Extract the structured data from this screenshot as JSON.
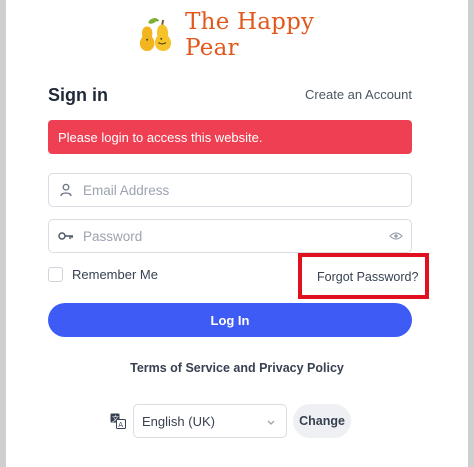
{
  "brand": {
    "name": "The Happy Pear",
    "logo_icon": "pear-icon"
  },
  "header": {
    "title": "Sign in",
    "create_account": "Create an Account"
  },
  "alert": {
    "message": "Please login to access this website.",
    "color": "#ef4053"
  },
  "form": {
    "email": {
      "placeholder": "Email Address",
      "value": "",
      "icon": "user-icon"
    },
    "password": {
      "placeholder": "Password",
      "value": "",
      "icon": "key-icon",
      "toggle_icon": "eye-icon"
    },
    "remember_me": {
      "label": "Remember Me",
      "checked": false
    },
    "forgot_password": "Forgot Password?",
    "login_button": "Log In"
  },
  "footer": {
    "terms": "Terms of Service and Privacy Policy",
    "language": {
      "selected": "English (UK)",
      "change_button": "Change",
      "icon": "translate-icon"
    }
  },
  "colors": {
    "accent": "#3e5bf5",
    "brand": "#e2581c",
    "highlight": "#e0101e"
  }
}
